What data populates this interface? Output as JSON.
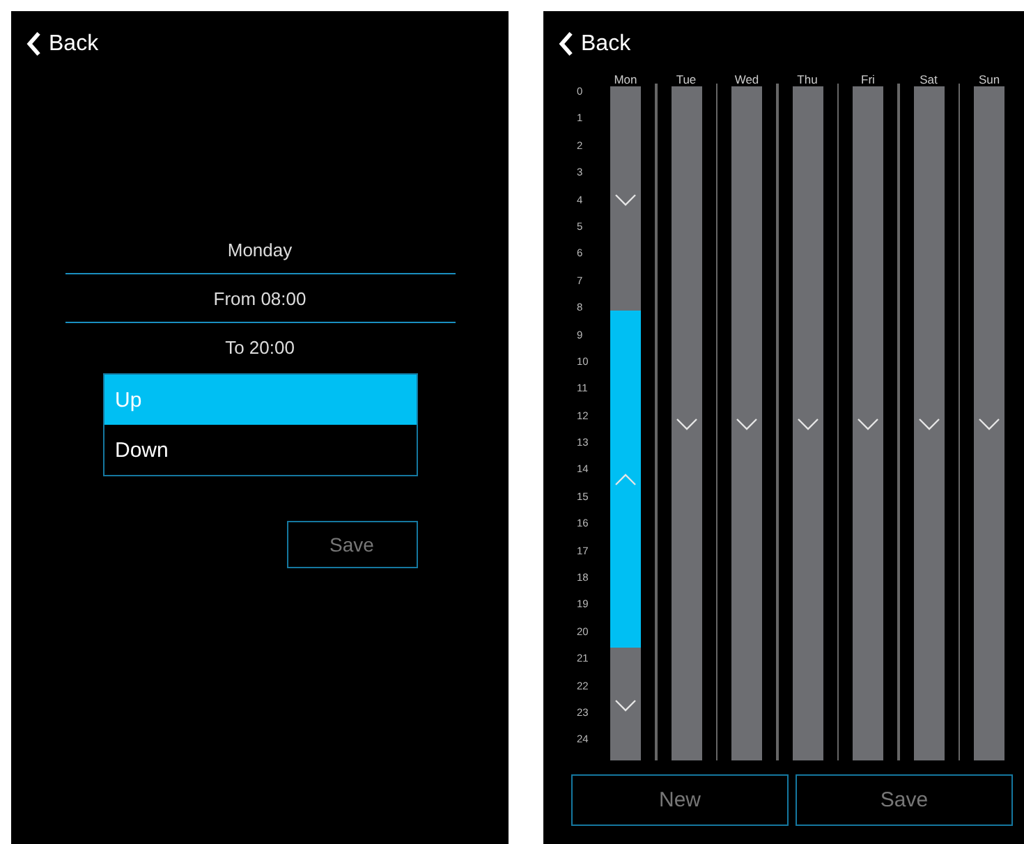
{
  "edit_screen": {
    "back": "Back",
    "day": "Monday",
    "from": "From 08:00",
    "to": "To 20:00",
    "options": [
      {
        "label": "Up",
        "selected": true
      },
      {
        "label": "Down",
        "selected": false
      }
    ],
    "save": "Save"
  },
  "schedule_screen": {
    "back": "Back",
    "hours": [
      "0",
      "1",
      "2",
      "3",
      "4",
      "5",
      "6",
      "7",
      "8",
      "9",
      "10",
      "11",
      "12",
      "13",
      "14",
      "15",
      "16",
      "17",
      "18",
      "19",
      "20",
      "21",
      "22",
      "23",
      "24"
    ],
    "days": [
      {
        "label": "Mon",
        "slots": [
          {
            "on": false
          },
          {
            "on": false
          },
          {
            "on": false
          },
          {
            "on": false
          },
          {
            "on": false
          },
          {
            "on": false
          },
          {
            "on": false
          },
          {
            "on": false
          },
          {
            "on": true
          },
          {
            "on": true
          },
          {
            "on": true
          },
          {
            "on": true
          },
          {
            "on": true
          },
          {
            "on": true
          },
          {
            "on": true
          },
          {
            "on": true
          },
          {
            "on": true
          },
          {
            "on": true
          },
          {
            "on": true
          },
          {
            "on": true
          },
          {
            "on": false
          },
          {
            "on": false
          },
          {
            "on": false
          },
          {
            "on": false
          }
        ]
      },
      {
        "label": "Tue",
        "slots": [
          {
            "on": false
          },
          {
            "on": false
          },
          {
            "on": false
          },
          {
            "on": false
          },
          {
            "on": false
          },
          {
            "on": false
          },
          {
            "on": false
          },
          {
            "on": false
          },
          {
            "on": false
          },
          {
            "on": false
          },
          {
            "on": false
          },
          {
            "on": false
          },
          {
            "on": false
          },
          {
            "on": false
          },
          {
            "on": false
          },
          {
            "on": false
          },
          {
            "on": false
          },
          {
            "on": false
          },
          {
            "on": false
          },
          {
            "on": false
          },
          {
            "on": false
          },
          {
            "on": false
          },
          {
            "on": false
          },
          {
            "on": false
          }
        ]
      },
      {
        "label": "Wed",
        "slots": [
          {
            "on": false
          },
          {
            "on": false
          },
          {
            "on": false
          },
          {
            "on": false
          },
          {
            "on": false
          },
          {
            "on": false
          },
          {
            "on": false
          },
          {
            "on": false
          },
          {
            "on": false
          },
          {
            "on": false
          },
          {
            "on": false
          },
          {
            "on": false
          },
          {
            "on": false
          },
          {
            "on": false
          },
          {
            "on": false
          },
          {
            "on": false
          },
          {
            "on": false
          },
          {
            "on": false
          },
          {
            "on": false
          },
          {
            "on": false
          },
          {
            "on": false
          },
          {
            "on": false
          },
          {
            "on": false
          },
          {
            "on": false
          }
        ]
      },
      {
        "label": "Thu",
        "slots": [
          {
            "on": false
          },
          {
            "on": false
          },
          {
            "on": false
          },
          {
            "on": false
          },
          {
            "on": false
          },
          {
            "on": false
          },
          {
            "on": false
          },
          {
            "on": false
          },
          {
            "on": false
          },
          {
            "on": false
          },
          {
            "on": false
          },
          {
            "on": false
          },
          {
            "on": false
          },
          {
            "on": false
          },
          {
            "on": false
          },
          {
            "on": false
          },
          {
            "on": false
          },
          {
            "on": false
          },
          {
            "on": false
          },
          {
            "on": false
          },
          {
            "on": false
          },
          {
            "on": false
          },
          {
            "on": false
          },
          {
            "on": false
          }
        ]
      },
      {
        "label": "Fri",
        "slots": [
          {
            "on": false
          },
          {
            "on": false
          },
          {
            "on": false
          },
          {
            "on": false
          },
          {
            "on": false
          },
          {
            "on": false
          },
          {
            "on": false
          },
          {
            "on": false
          },
          {
            "on": false
          },
          {
            "on": false
          },
          {
            "on": false
          },
          {
            "on": false
          },
          {
            "on": false
          },
          {
            "on": false
          },
          {
            "on": false
          },
          {
            "on": false
          },
          {
            "on": false
          },
          {
            "on": false
          },
          {
            "on": false
          },
          {
            "on": false
          },
          {
            "on": false
          },
          {
            "on": false
          },
          {
            "on": false
          },
          {
            "on": false
          }
        ]
      },
      {
        "label": "Sat",
        "slots": [
          {
            "on": false
          },
          {
            "on": false
          },
          {
            "on": false
          },
          {
            "on": false
          },
          {
            "on": false
          },
          {
            "on": false
          },
          {
            "on": false
          },
          {
            "on": false
          },
          {
            "on": false
          },
          {
            "on": false
          },
          {
            "on": false
          },
          {
            "on": false
          },
          {
            "on": false
          },
          {
            "on": false
          },
          {
            "on": false
          },
          {
            "on": false
          },
          {
            "on": false
          },
          {
            "on": false
          },
          {
            "on": false
          },
          {
            "on": false
          },
          {
            "on": false
          },
          {
            "on": false
          },
          {
            "on": false
          },
          {
            "on": false
          }
        ]
      },
      {
        "label": "Sun",
        "slots": [
          {
            "on": false
          },
          {
            "on": false
          },
          {
            "on": false
          },
          {
            "on": false
          },
          {
            "on": false
          },
          {
            "on": false
          },
          {
            "on": false
          },
          {
            "on": false
          },
          {
            "on": false
          },
          {
            "on": false
          },
          {
            "on": false
          },
          {
            "on": false
          },
          {
            "on": false
          },
          {
            "on": false
          },
          {
            "on": false
          },
          {
            "on": false
          },
          {
            "on": false
          },
          {
            "on": false
          },
          {
            "on": false
          },
          {
            "on": false
          },
          {
            "on": false
          },
          {
            "on": false
          },
          {
            "on": false
          },
          {
            "on": false
          }
        ]
      }
    ],
    "buttons": [
      "New",
      "Save"
    ]
  }
}
